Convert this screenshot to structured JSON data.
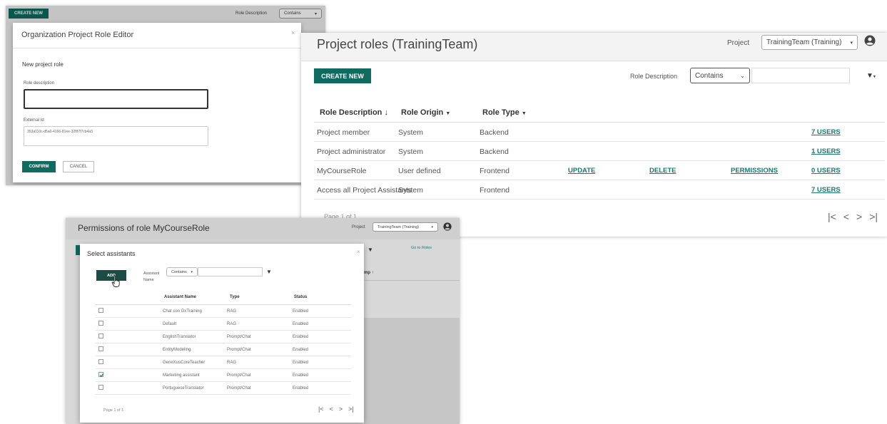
{
  "editor_window": {
    "create_new": "CREATE NEW",
    "role_description_label": "Role Description",
    "filter_select": "Contains",
    "dialog_title": "Organization Project Role Editor",
    "section_title": "New project role",
    "role_description_field_label": "Role description",
    "role_description_value": "",
    "external_id_label": "External Id",
    "external_id_value": "353a110c-d5a0-4166-81ee-32f87f7cb4a3",
    "confirm": "CONFIRM",
    "cancel": "CANCEL"
  },
  "roles_window": {
    "title": "Project roles (TrainingTeam)",
    "project_label": "Project",
    "project_select": "TrainingTeam (Training)",
    "create_new": "CREATE NEW",
    "role_description_label": "Role Description",
    "filter_select": "Contains",
    "filter_value": "",
    "columns": [
      "Role Description",
      "Role Origin",
      "Role Type"
    ],
    "rows": [
      {
        "description": "Project member",
        "origin": "System",
        "type": "Backend",
        "update": "",
        "delete": "",
        "permissions": "",
        "users": "7 USERS"
      },
      {
        "description": "Project administrator",
        "origin": "System",
        "type": "Backend",
        "update": "",
        "delete": "",
        "permissions": "",
        "users": "1 USERS"
      },
      {
        "description": "MyCourseRole",
        "origin": "User defined",
        "type": "Frontend",
        "update": "UPDATE",
        "delete": "DELETE",
        "permissions": "PERMISSIONS",
        "users": "0 USERS"
      },
      {
        "description": "Access all Project Assistants",
        "origin": "System",
        "type": "Frontend",
        "update": "",
        "delete": "",
        "permissions": "",
        "users": "7 USERS"
      }
    ],
    "pagination": "Page 1 of 1"
  },
  "permissions_window": {
    "title": "Permissions of role MyCourseRole",
    "project_label": "Project",
    "project_select": "TrainingTeam (Training)",
    "go_to_roles": "Go to Roles",
    "bg_column_fragment": "mp",
    "dialog": {
      "title": "Select assistants",
      "add": "ADD",
      "filter_label": "Assistant Name",
      "filter_select": "Contains",
      "filter_value": "",
      "columns": [
        "Assistant Name",
        "Type",
        "Status"
      ],
      "rows": [
        {
          "name": "Chat con GxTraining",
          "type": "RAG",
          "status": "Enabled",
          "checked": false
        },
        {
          "name": "Default",
          "type": "RAG",
          "status": "Enabled",
          "checked": false
        },
        {
          "name": "EnglishTranslator",
          "type": "Prompt/Chat",
          "status": "Enabled",
          "checked": false
        },
        {
          "name": "EntityModeling",
          "type": "Prompt/Chat",
          "status": "Enabled",
          "checked": false
        },
        {
          "name": "GeneXusCoreTeacher",
          "type": "RAG",
          "status": "Enabled",
          "checked": false
        },
        {
          "name": "Marketing assistant",
          "type": "Prompt/Chat",
          "status": "Enabled",
          "checked": true
        },
        {
          "name": "PortugueseTranslator",
          "type": "Prompt/Chat",
          "status": "Enabled",
          "checked": false
        }
      ],
      "pagination": "Page 1 of 1"
    }
  },
  "colors": {
    "primary": "#0f6b5f",
    "link": "#1b7a6e"
  }
}
